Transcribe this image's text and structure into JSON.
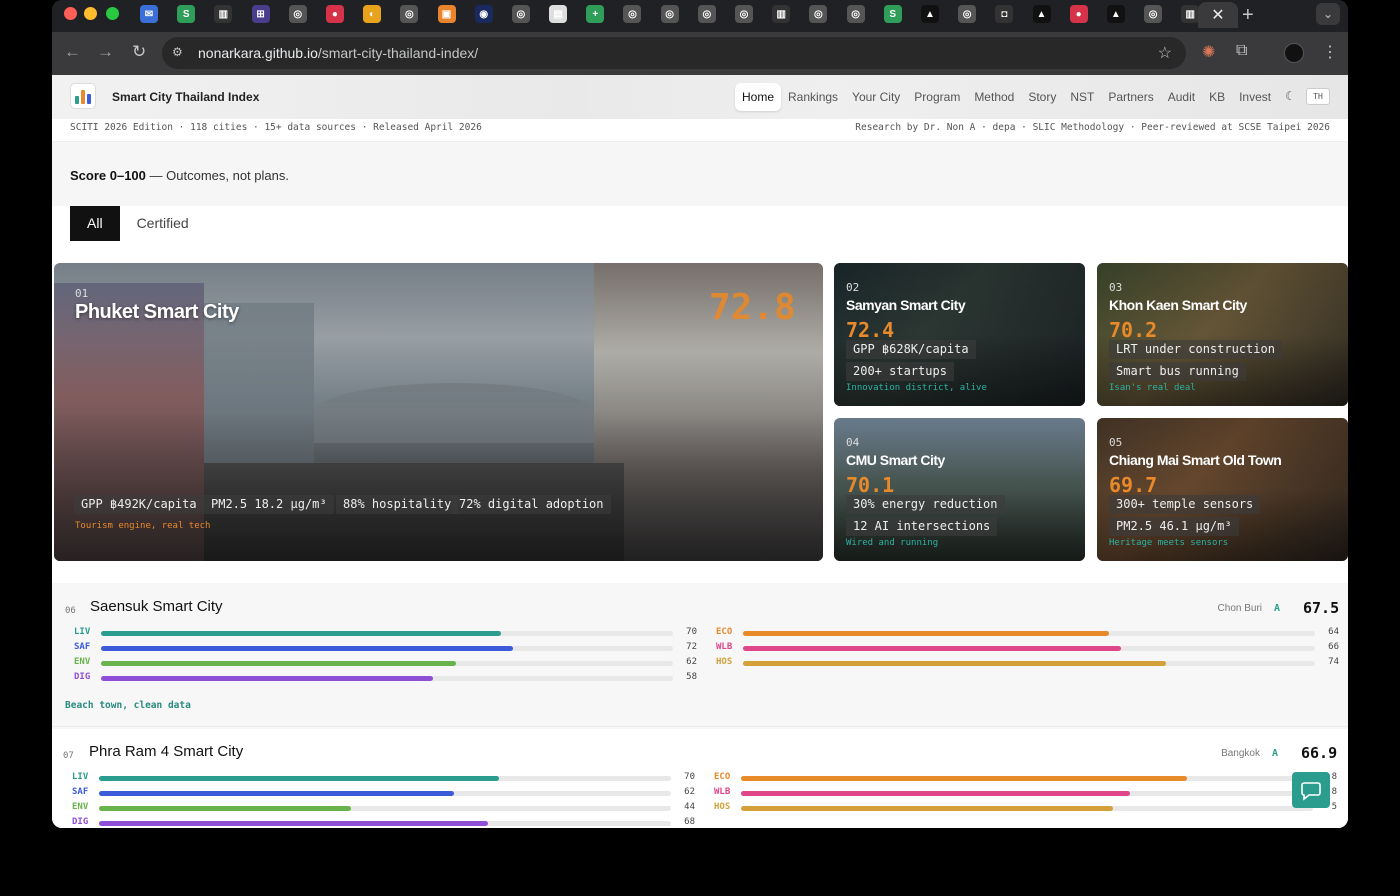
{
  "browser": {
    "url_host": "nonarkara.github.io",
    "url_path": "/smart-city-thailand-index/",
    "tab_icons": [
      {
        "name": "gmail-icon",
        "color": "#3b6fd8",
        "glyph": "✉"
      },
      {
        "name": "sheets-s-icon",
        "color": "#2f9e5a",
        "glyph": "S"
      },
      {
        "name": "chart-icon",
        "color": "#333",
        "glyph": "▥"
      },
      {
        "name": "grid-icon",
        "color": "#4a3e8c",
        "glyph": "⊞"
      },
      {
        "name": "globe-icon",
        "color": "#555",
        "glyph": "◎"
      },
      {
        "name": "record-icon",
        "color": "#d6334a",
        "glyph": "●"
      },
      {
        "name": "gauge-icon",
        "color": "#e8a21c",
        "glyph": "◐"
      },
      {
        "name": "globe-icon",
        "color": "#555",
        "glyph": "◎"
      },
      {
        "name": "orange-box-icon",
        "color": "#e8842c",
        "glyph": "▣"
      },
      {
        "name": "circle-dot-icon",
        "color": "#1b2a5e",
        "glyph": "◉"
      },
      {
        "name": "globe-icon",
        "color": "#555",
        "glyph": "◎"
      },
      {
        "name": "doc-icon",
        "color": "#dedede",
        "glyph": "▤"
      },
      {
        "name": "plus-icon",
        "color": "#2f9e5a",
        "glyph": "+"
      },
      {
        "name": "globe-icon",
        "color": "#555",
        "glyph": "◎"
      },
      {
        "name": "globe-icon",
        "color": "#555",
        "glyph": "◎"
      },
      {
        "name": "globe-icon",
        "color": "#555",
        "glyph": "◎"
      },
      {
        "name": "globe-icon",
        "color": "#555",
        "glyph": "◎"
      },
      {
        "name": "chart-icon",
        "color": "#333",
        "glyph": "▥"
      },
      {
        "name": "globe-icon",
        "color": "#555",
        "glyph": "◎"
      },
      {
        "name": "globe-icon",
        "color": "#555",
        "glyph": "◎"
      },
      {
        "name": "sheets-s-icon",
        "color": "#2f9e5a",
        "glyph": "S"
      },
      {
        "name": "triangle-icon",
        "color": "#111",
        "glyph": "▲"
      },
      {
        "name": "globe-icon",
        "color": "#555",
        "glyph": "◎"
      },
      {
        "name": "robot-icon",
        "color": "#333",
        "glyph": "◘"
      },
      {
        "name": "triangle-icon",
        "color": "#111",
        "glyph": "▲"
      },
      {
        "name": "record-icon",
        "color": "#d6334a",
        "glyph": "●"
      },
      {
        "name": "triangle-icon",
        "color": "#111",
        "glyph": "▲"
      },
      {
        "name": "globe-icon",
        "color": "#555",
        "glyph": "◎"
      },
      {
        "name": "chart-icon",
        "color": "#333",
        "glyph": "▥"
      }
    ]
  },
  "site": {
    "brand": "Smart City Thailand Index",
    "nav": [
      "Home",
      "Rankings",
      "Your City",
      "Program",
      "Method",
      "Story",
      "NST",
      "Partners",
      "Audit",
      "KB",
      "Invest"
    ],
    "lang_button": "TH",
    "meta_left": "SCITI 2026 Edition · 118 cities · 15+ data sources · Released April 2026",
    "meta_right": "Research by Dr. Non A · depa · SLIC Methodology · Peer-reviewed at SCSE Taipei 2026",
    "score_strong": "Score 0–100",
    "score_rest": " — Outcomes, not plans.",
    "filters": [
      "All",
      "Certified"
    ],
    "accent": "#e8892a",
    "teal": "#2a9d8f"
  },
  "cards": [
    {
      "num": "01",
      "title": "Phuket Smart City",
      "score": "72.8",
      "chips": [
        "GPP ฿492K/capita",
        "PM2.5 18.2 µg/m³",
        "88% hospitality",
        "72% digital adoption"
      ],
      "tag": "Tourism engine, real tech",
      "tag_color": "#e8892a"
    },
    {
      "num": "02",
      "title": "Samyan Smart City",
      "score": "72.4",
      "chips": [
        "GPP ฿628K/capita",
        "200+ startups"
      ],
      "tag": "Innovation district, alive",
      "tag_color": "#2ab3a3"
    },
    {
      "num": "03",
      "title": "Khon Kaen Smart City",
      "score": "70.2",
      "chips": [
        "LRT under construction",
        "Smart bus running"
      ],
      "tag": "Isan's real deal",
      "tag_color": "#2ab3a3"
    },
    {
      "num": "04",
      "title": "CMU Smart City",
      "score": "70.1",
      "chips": [
        "30% energy reduction",
        "12 AI intersections"
      ],
      "tag": "Wired and running",
      "tag_color": "#2ab3a3"
    },
    {
      "num": "05",
      "title": "Chiang Mai Smart Old Town",
      "score": "69.7",
      "chips": [
        "300+ temple sensors",
        "PM2.5 46.1 µg/m³"
      ],
      "tag": "Heritage meets sensors",
      "tag_color": "#2ab3a3"
    }
  ],
  "rows": [
    {
      "num": "06",
      "title": "Saensuk Smart City",
      "province": "Chon Buri",
      "grade": "A",
      "score": "67.5",
      "tag": "Beach town, clean data",
      "left": [
        {
          "label": "LIV",
          "value": 70,
          "color": "#2a9d8f"
        },
        {
          "label": "SAF",
          "value": 72,
          "color": "#3b5bdb"
        },
        {
          "label": "ENV",
          "value": 62,
          "color": "#69b34c"
        },
        {
          "label": "DIG",
          "value": 58,
          "color": "#8e4fd6"
        }
      ],
      "right": [
        {
          "label": "ECO",
          "value": 64,
          "color": "#e8892a"
        },
        {
          "label": "WLB",
          "value": 66,
          "color": "#e0468a"
        },
        {
          "label": "HOS",
          "value": 74,
          "color": "#d4a03a"
        }
      ]
    },
    {
      "num": "07",
      "title": "Phra Ram 4 Smart City",
      "province": "Bangkok",
      "grade": "A",
      "score": "66.9",
      "tag": "",
      "left": [
        {
          "label": "LIV",
          "value": 70,
          "color": "#2a9d8f"
        },
        {
          "label": "SAF",
          "value": 62,
          "color": "#3b5bdb"
        },
        {
          "label": "ENV",
          "value": 44,
          "color": "#69b34c"
        },
        {
          "label": "DIG",
          "value": 68,
          "color": "#8e4fd6"
        }
      ],
      "right": [
        {
          "label": "ECO",
          "value": 78,
          "color": "#e8892a",
          "shown": "8"
        },
        {
          "label": "WLB",
          "value": 68,
          "color": "#e0468a",
          "shown": "8"
        },
        {
          "label": "HOS",
          "value": 65,
          "color": "#d4a03a",
          "shown": "5"
        }
      ]
    }
  ]
}
